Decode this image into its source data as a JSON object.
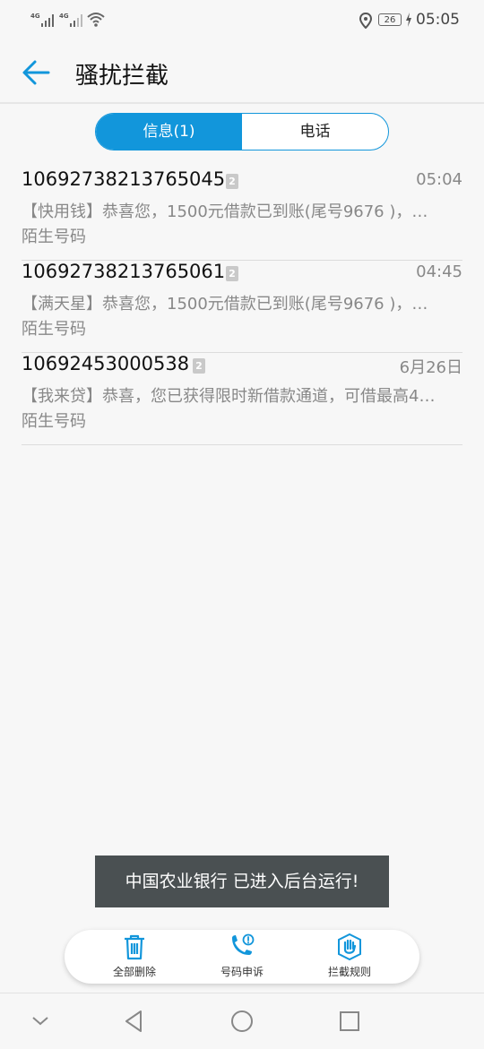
{
  "status": {
    "sim1": "4G",
    "sim2": "4G",
    "battery": "26",
    "time": "05:05"
  },
  "header": {
    "title": "骚扰拦截",
    "back_icon": "back-arrow-icon"
  },
  "tabs": [
    {
      "label": "信息(1)",
      "active": true
    },
    {
      "label": "电话",
      "active": false
    }
  ],
  "messages": [
    {
      "number": "10692738213765045",
      "sim": "2",
      "time": "05:04",
      "preview": "【快用钱】恭喜您，1500元借款已到账(尾号9676 )，…",
      "tag": "陌生号码"
    },
    {
      "number": "10692738213765061",
      "sim": "2",
      "time": "04:45",
      "preview": "【满天星】恭喜您，1500元借款已到账(尾号9676 )，…",
      "tag": "陌生号码"
    },
    {
      "number": "10692453000538",
      "sim": "2",
      "time": "6月26日",
      "preview": "【我来贷】恭喜，您已获得限时新借款通道，可借最高4…",
      "tag": "陌生号码"
    }
  ],
  "toast": "中国农业银行 已进入后台运行!",
  "actions": [
    {
      "label": "全部删除",
      "icon": "trash-icon"
    },
    {
      "label": "号码申诉",
      "icon": "phone-alert-icon"
    },
    {
      "label": "拦截规则",
      "icon": "hand-shield-icon"
    }
  ],
  "colors": {
    "accent": "#1296db",
    "toast_bg": "#4a5052"
  }
}
